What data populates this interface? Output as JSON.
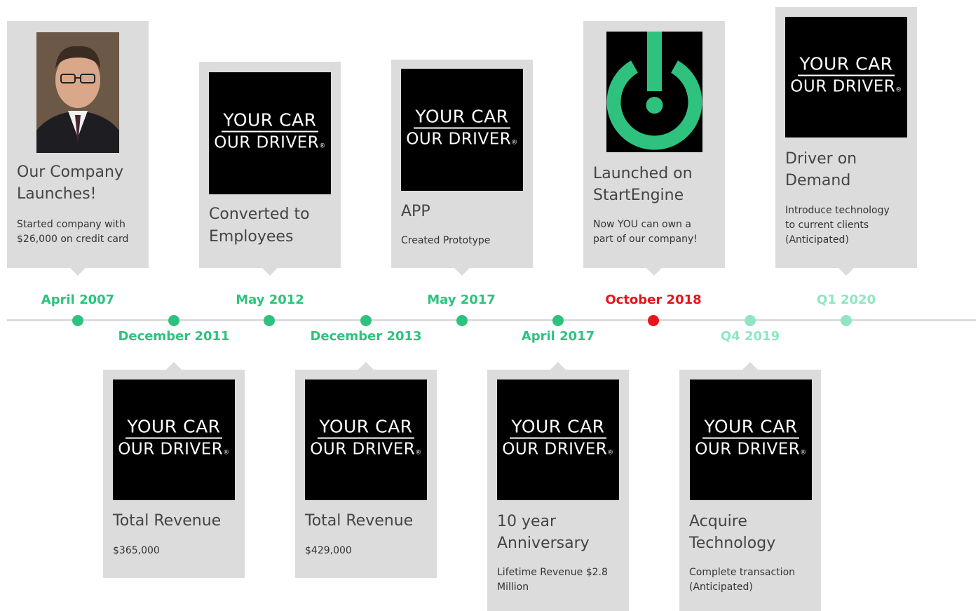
{
  "colors": {
    "accent_green": "#2ec27e",
    "highlight_red": "#e8141b",
    "future_green": "#8fe6c0",
    "card_bg": "#dcdcdc",
    "axis": "#dcdcdc"
  },
  "logo": {
    "line1": "YOUR CAR",
    "line2": "OUR DRIVER",
    "mark": "®"
  },
  "events": [
    {
      "date": "April 2007",
      "title_1": "Our Company",
      "title_2": "Launches!",
      "desc_1": "Started company with",
      "desc_2": "$26,000 on credit card",
      "image": "founder-photo"
    },
    {
      "date": "December 2011",
      "title_1": "Total Revenue",
      "title_2": "",
      "desc_1": "$365,000",
      "desc_2": "",
      "image": "company-logo"
    },
    {
      "date": "May 2012",
      "title_1": "Converted to",
      "title_2": "Employees",
      "desc_1": "",
      "desc_2": "",
      "image": "company-logo"
    },
    {
      "date": "December 2013",
      "title_1": "Total Revenue",
      "title_2": "",
      "desc_1": "$429,000",
      "desc_2": "",
      "image": "company-logo"
    },
    {
      "date": "May 2017",
      "title_1": "APP",
      "title_2": "",
      "desc_1": "Created Prototype",
      "desc_2": "",
      "image": "company-logo"
    },
    {
      "date": "April 2017",
      "title_1": "10 year",
      "title_2": "Anniversary",
      "desc_1": "Lifetime Revenue $2.8",
      "desc_2": "Million",
      "image": "company-logo"
    },
    {
      "date": "October 2018",
      "title_1": "Launched on",
      "title_2": "StartEngine",
      "desc_1": "Now YOU can own a",
      "desc_2": "part of our company!",
      "image": "startengine-power-icon"
    },
    {
      "date": "Q4 2019",
      "title_1": "Acquire",
      "title_2": "Technology",
      "desc_1": "Complete transaction",
      "desc_2": "(Anticipated)",
      "image": "company-logo"
    },
    {
      "date": "Q1 2020",
      "title_1": "Driver on",
      "title_2": "Demand",
      "desc_1": "Introduce technology",
      "desc_2": "to current clients",
      "desc_3": "(Anticipated)",
      "image": "company-logo"
    }
  ]
}
